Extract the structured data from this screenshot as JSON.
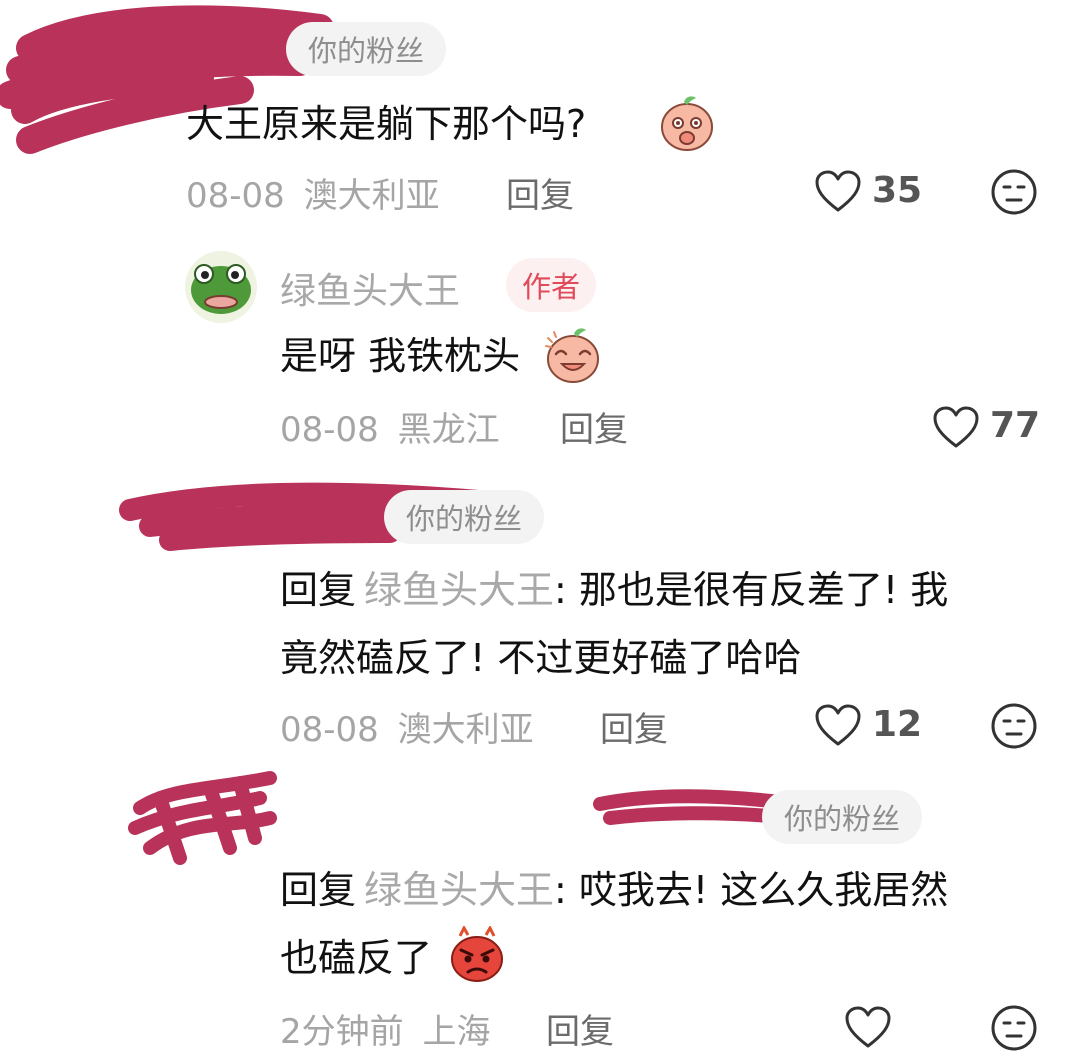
{
  "comments": [
    {
      "fan_badge": "你的粉丝",
      "text": "大王原来是躺下那个吗?",
      "date": "08-08",
      "location": "澳大利亚",
      "reply_label": "回复",
      "likes": "35"
    },
    {
      "username": "绿鱼头大王",
      "author_badge": "作者",
      "text": "是呀 我铁枕头",
      "date": "08-08",
      "location": "黑龙江",
      "reply_label": "回复",
      "likes": "77"
    },
    {
      "fan_badge": "你的粉丝",
      "reply_prefix": "回复",
      "mention": "绿鱼头大王",
      "text_line1": ": 那也是很有反差了! 我",
      "text_line2": "竟然磕反了! 不过更好磕了哈哈",
      "date": "08-08",
      "location": "澳大利亚",
      "reply_label": "回复",
      "likes": "12"
    },
    {
      "fan_badge": "你的粉丝",
      "reply_prefix": "回复",
      "mention": "绿鱼头大王",
      "text_line1": ": 哎我去! 这么久我居然",
      "text_line2": "也磕反了",
      "date": "2分钟前",
      "location": "上海",
      "reply_label": "回复"
    }
  ],
  "icons": {
    "like": "heart-outline-icon",
    "dislike": "neutral-face-icon",
    "emoji_blush": "peach-shy-emoji",
    "emoji_grin": "peach-grin-emoji",
    "emoji_angry": "angry-red-emoji"
  },
  "colors": {
    "redaction": "#b8325a",
    "author_badge_text": "#e04a59",
    "author_badge_bg": "#fdf0f1",
    "fan_badge_bg": "#f3f3f3",
    "muted_text": "#a5a5a5"
  }
}
